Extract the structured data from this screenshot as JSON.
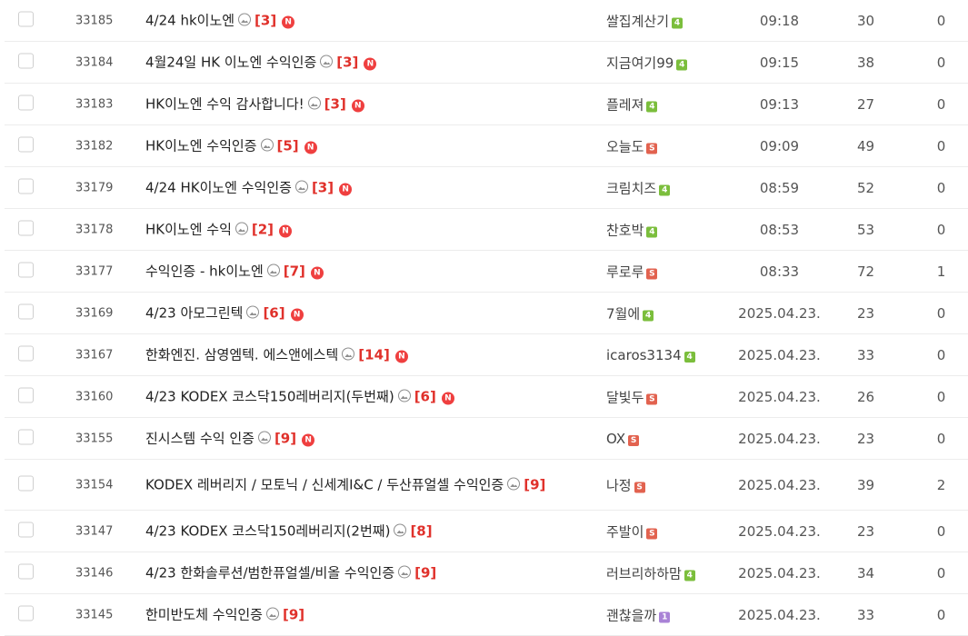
{
  "colors": {
    "level_green": "#7bbe3c",
    "level_red": "#e2624f",
    "level_purple": "#a982d6",
    "new_badge": "#ef3f3f",
    "comment_count": "#e0312b"
  },
  "rows": [
    {
      "num": "33185",
      "title": "4/24 hk이노엔",
      "comments": "[3]",
      "new": "N",
      "author": "쌀집계산기",
      "level": "4",
      "level_color": "green",
      "date": "09:18",
      "views": "30",
      "likes": "0"
    },
    {
      "num": "33184",
      "title": "4월24일 HK 이노엔 수익인증",
      "comments": "[3]",
      "new": "N",
      "author": "지금여기99",
      "level": "4",
      "level_color": "green",
      "date": "09:15",
      "views": "38",
      "likes": "0"
    },
    {
      "num": "33183",
      "title": "HK이노엔 수익 감사합니다!",
      "comments": "[3]",
      "new": "N",
      "author": "플레져",
      "level": "4",
      "level_color": "green",
      "date": "09:13",
      "views": "27",
      "likes": "0"
    },
    {
      "num": "33182",
      "title": "HK이노엔 수익인증",
      "comments": "[5]",
      "new": "N",
      "author": "오늘도",
      "level": "S",
      "level_color": "red",
      "date": "09:09",
      "views": "49",
      "likes": "0"
    },
    {
      "num": "33179",
      "title": "4/24 HK이노엔 수익인증",
      "comments": "[3]",
      "new": "N",
      "author": "크림치즈",
      "level": "4",
      "level_color": "green",
      "date": "08:59",
      "views": "52",
      "likes": "0"
    },
    {
      "num": "33178",
      "title": "HK이노엔 수익",
      "comments": "[2]",
      "new": "N",
      "author": "찬호박",
      "level": "4",
      "level_color": "green",
      "date": "08:53",
      "views": "53",
      "likes": "0"
    },
    {
      "num": "33177",
      "title": "수익인증 - hk이노엔",
      "comments": "[7]",
      "new": "N",
      "author": "루로루",
      "level": "S",
      "level_color": "red",
      "date": "08:33",
      "views": "72",
      "likes": "1"
    },
    {
      "num": "33169",
      "title": "4/23 아모그린텍",
      "comments": "[6]",
      "new": "N",
      "author": "7월에",
      "level": "4",
      "level_color": "green",
      "date": "2025.04.23.",
      "views": "23",
      "likes": "0"
    },
    {
      "num": "33167",
      "title": "한화엔진. 삼영엠텍. 에스앤에스텍",
      "comments": "[14]",
      "new": "N",
      "author": "icaros3134",
      "level": "4",
      "level_color": "green",
      "date": "2025.04.23.",
      "views": "33",
      "likes": "0"
    },
    {
      "num": "33160",
      "title": "4/23 KODEX 코스닥150레버리지(두번째)",
      "comments": "[6]",
      "new": "N",
      "author": "달빛두",
      "level": "S",
      "level_color": "red",
      "date": "2025.04.23.",
      "views": "26",
      "likes": "0"
    },
    {
      "num": "33155",
      "title": "진시스템 수익 인증",
      "comments": "[9]",
      "new": "N",
      "author": "OX",
      "level": "S",
      "level_color": "red",
      "date": "2025.04.23.",
      "views": "23",
      "likes": "0"
    },
    {
      "num": "33154",
      "title": "KODEX 레버리지 / 모토닉 / 신세계I&C / 두산퓨얼셀 수익인증",
      "comments": "[9]",
      "new": "",
      "author": "나정",
      "level": "S",
      "level_color": "red",
      "date": "2025.04.23.",
      "views": "39",
      "likes": "2",
      "tall": true
    },
    {
      "num": "33147",
      "title": "4/23 KODEX 코스닥150레버리지(2번째)",
      "comments": "[8]",
      "new": "",
      "author": "주발이",
      "level": "S",
      "level_color": "red",
      "date": "2025.04.23.",
      "views": "23",
      "likes": "0"
    },
    {
      "num": "33146",
      "title": "4/23 한화솔루션/범한퓨얼셀/비올 수익인증",
      "comments": "[9]",
      "new": "",
      "author": "러브리하하맘",
      "level": "4",
      "level_color": "green",
      "date": "2025.04.23.",
      "views": "34",
      "likes": "0"
    },
    {
      "num": "33145",
      "title": "한미반도체 수익인증",
      "comments": "[9]",
      "new": "",
      "author": "괜찮을까",
      "level": "1",
      "level_color": "purple",
      "date": "2025.04.23.",
      "views": "33",
      "likes": "0"
    }
  ]
}
